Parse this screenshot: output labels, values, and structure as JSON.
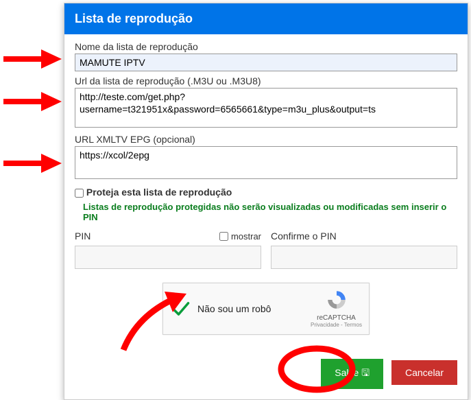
{
  "header": {
    "title": "Lista de reprodução"
  },
  "fields": {
    "name_label": "Nome da lista de reprodução",
    "name_value": "MAMUTE IPTV",
    "url_label": "Url da lista de reprodução (.M3U ou .M3U8)",
    "url_value": "http://teste.com/get.php?username=t321951x&password=6565661&type=m3u_plus&output=ts",
    "epg_label": "URL XMLTV EPG (opcional)",
    "epg_value": "https://xcol/2epg"
  },
  "protect": {
    "checkbox_label": "Proteja esta lista de reprodução",
    "hint": "Listas de reprodução protegidas não serão visualizadas ou modificadas sem inserir o PIN",
    "pin_label": "PIN",
    "show_label": "mostrar",
    "confirm_label": "Confirme o PIN"
  },
  "recaptcha": {
    "text": "Não sou um robô",
    "brand": "reCAPTCHA",
    "links": "Privacidade - Termos"
  },
  "footer": {
    "save": "Salve 🖫",
    "cancel": "Cancelar"
  }
}
